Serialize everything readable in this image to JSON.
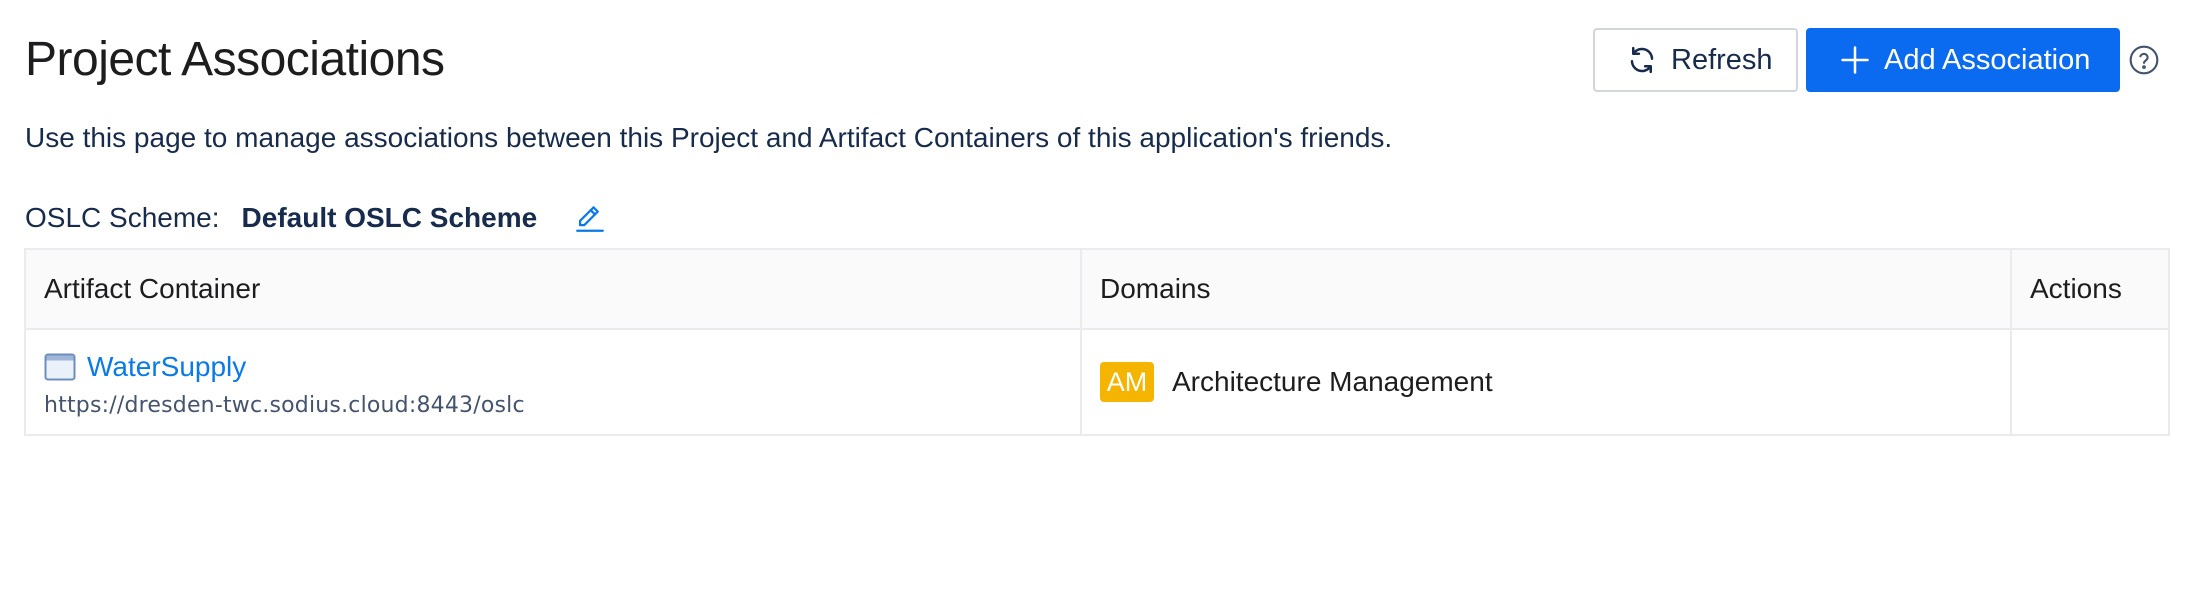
{
  "page": {
    "title": "Project Associations",
    "description": "Use this page to manage associations between this Project and Artifact Containers of this application's friends."
  },
  "toolbar": {
    "refresh_label": "Refresh",
    "add_label": "Add Association",
    "refresh_icon": "refresh-icon",
    "add_icon": "plus-icon",
    "help_icon": "help-circle-icon"
  },
  "oslc": {
    "label": "OSLC Scheme:",
    "value": "Default OSLC Scheme",
    "edit_icon": "pencil-icon"
  },
  "table": {
    "columns": [
      "Artifact Container",
      "Domains",
      "Actions"
    ],
    "rows": [
      {
        "container_name": "WaterSupply",
        "container_url": "https://dresden-twc.sodius.cloud:8443/oslc",
        "container_icon": "window-icon",
        "domain_badge": "AM",
        "domain_name": "Architecture Management",
        "actions": ""
      }
    ]
  },
  "colors": {
    "primary": "#0a6bf1",
    "link": "#0a7ae6",
    "badge_am": "#f5b400",
    "text": "#172b4d"
  }
}
